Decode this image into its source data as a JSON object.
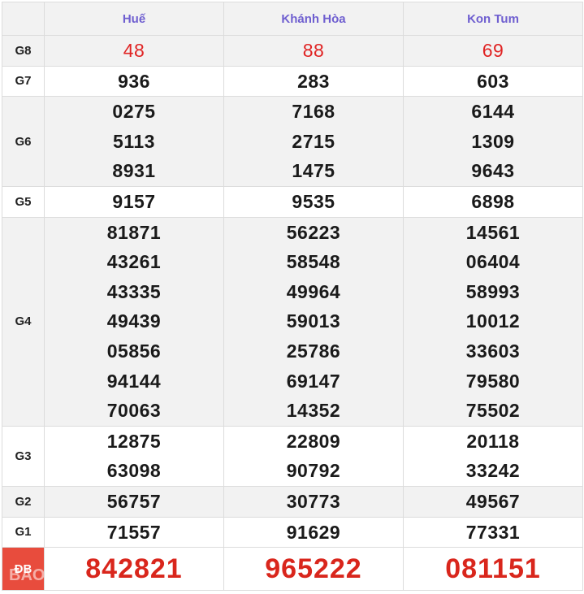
{
  "header": {
    "provinces": [
      "Huế",
      "Khánh Hòa",
      "Kon Tum"
    ]
  },
  "prizes": {
    "g8": {
      "label": "G8",
      "values": [
        [
          "48"
        ],
        [
          "88"
        ],
        [
          "69"
        ]
      ]
    },
    "g7": {
      "label": "G7",
      "values": [
        [
          "936"
        ],
        [
          "283"
        ],
        [
          "603"
        ]
      ]
    },
    "g6": {
      "label": "G6",
      "values": [
        [
          "0275",
          "5113",
          "8931"
        ],
        [
          "7168",
          "2715",
          "1475"
        ],
        [
          "6144",
          "1309",
          "9643"
        ]
      ]
    },
    "g5": {
      "label": "G5",
      "values": [
        [
          "9157"
        ],
        [
          "9535"
        ],
        [
          "6898"
        ]
      ]
    },
    "g4": {
      "label": "G4",
      "values": [
        [
          "81871",
          "43261",
          "43335",
          "49439",
          "05856",
          "94144",
          "70063"
        ],
        [
          "56223",
          "58548",
          "49964",
          "59013",
          "25786",
          "69147",
          "14352"
        ],
        [
          "14561",
          "06404",
          "58993",
          "10012",
          "33603",
          "79580",
          "75502"
        ]
      ]
    },
    "g3": {
      "label": "G3",
      "values": [
        [
          "12875",
          "63098"
        ],
        [
          "22809",
          "90792"
        ],
        [
          "20118",
          "33242"
        ]
      ]
    },
    "g2": {
      "label": "G2",
      "values": [
        [
          "56757"
        ],
        [
          "30773"
        ],
        [
          "49567"
        ]
      ]
    },
    "g1": {
      "label": "G1",
      "values": [
        [
          "71557"
        ],
        [
          "91629"
        ],
        [
          "77331"
        ]
      ]
    },
    "db": {
      "label": "ĐB",
      "values": [
        [
          "842821"
        ],
        [
          "965222"
        ],
        [
          "081151"
        ]
      ]
    }
  },
  "watermark": "BAOTUOITRE.COM",
  "colors": {
    "header_text": "#6f5fd0",
    "accent_red": "#e02424",
    "db_label_bg": "#e84c3d"
  }
}
